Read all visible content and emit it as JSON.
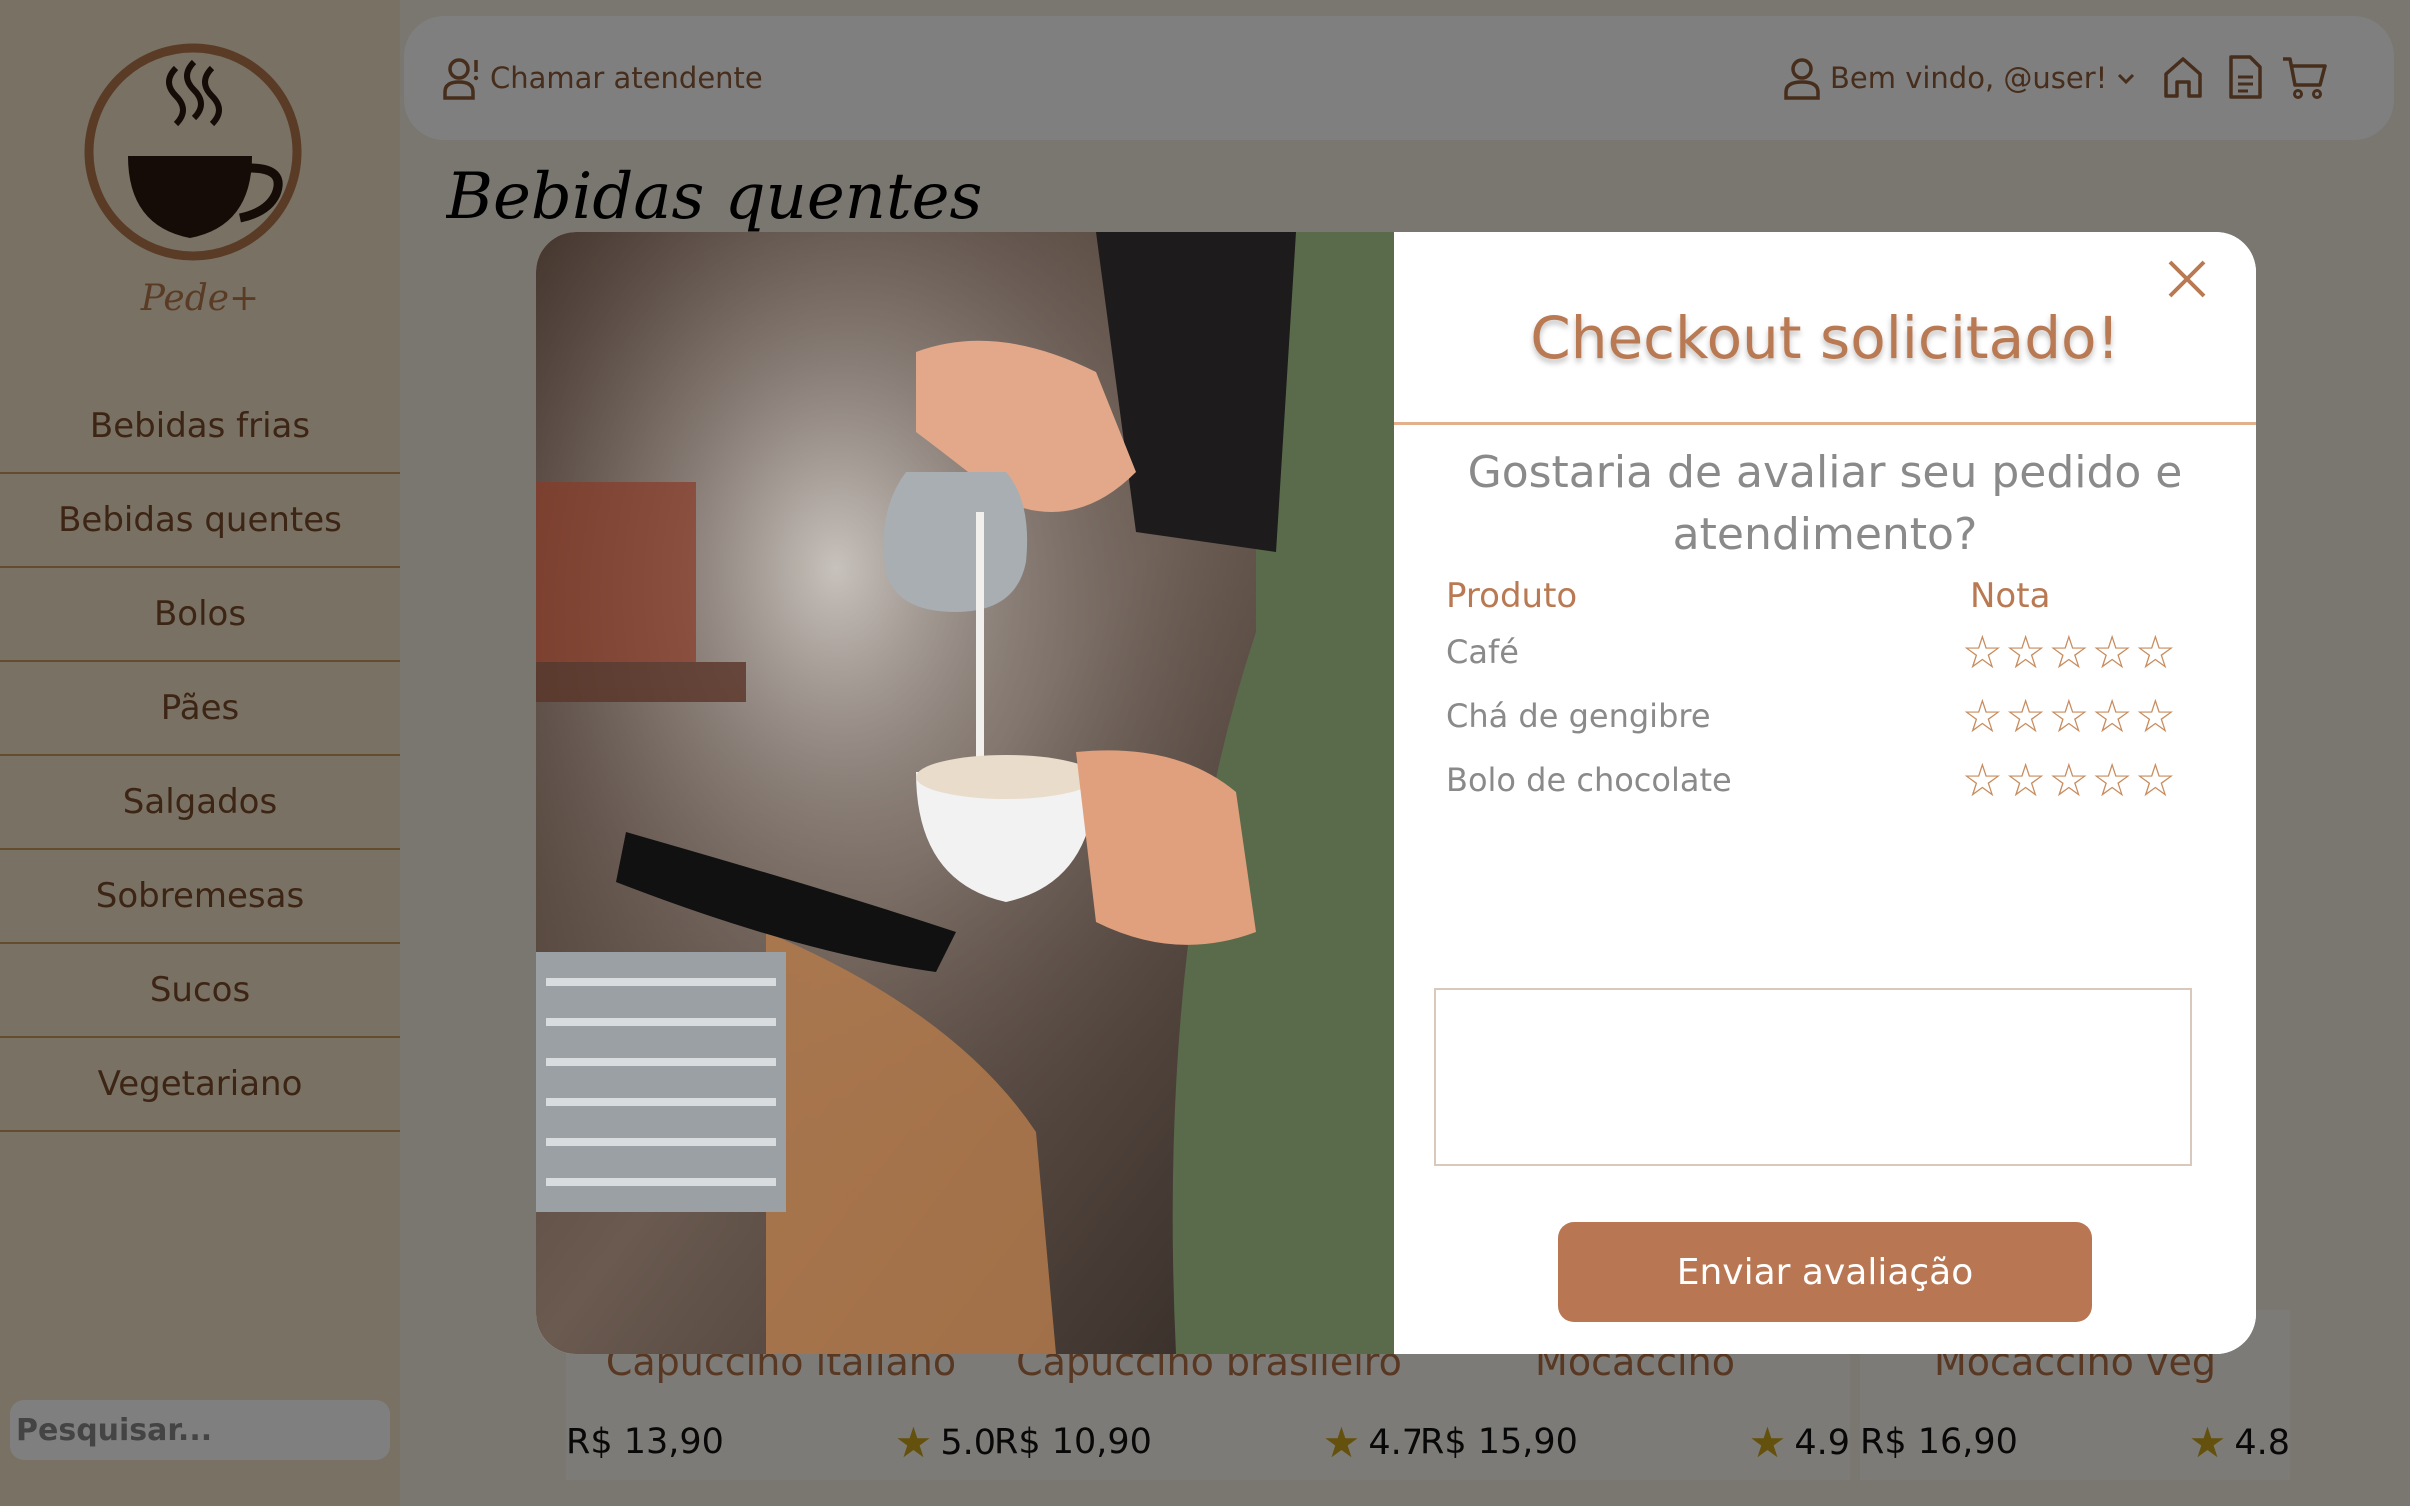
{
  "colors": {
    "accent": "#b97952",
    "sidebar_bg": "#f2e3c6",
    "overlay": "rgba(0,0,0,0.5)",
    "star_filled": "#c9a21c"
  },
  "brand": {
    "name": "Pede+",
    "logo_icon": "coffee-cup-icon"
  },
  "sidebar": {
    "items": [
      {
        "label": "Bebidas frias"
      },
      {
        "label": "Bebidas quentes"
      },
      {
        "label": "Bolos"
      },
      {
        "label": "Pães"
      },
      {
        "label": "Salgados"
      },
      {
        "label": "Sobremesas"
      },
      {
        "label": "Sucos"
      },
      {
        "label": "Vegetariano"
      }
    ],
    "search_placeholder": "Pesquisar..."
  },
  "topbar": {
    "call_attendant": "Chamar atendente",
    "welcome": "Bem vindo, @user!",
    "icons": [
      "home-icon",
      "document-icon",
      "cart-icon"
    ]
  },
  "page": {
    "title": "Bebidas quentes"
  },
  "products": [
    {
      "name": "Capuccino italiano",
      "price": "R$ 13,90",
      "rating": "5.0"
    },
    {
      "name": "Capuccino brasileiro",
      "price": "R$ 10,90",
      "rating": "4.7"
    },
    {
      "name": "Mocaccino",
      "price": "R$ 15,90",
      "rating": "4.9"
    },
    {
      "name": "Mocaccino veg",
      "price": "R$ 16,90",
      "rating": "4.8"
    }
  ],
  "modal": {
    "title": "Checkout solicitado!",
    "question": "Gostaria de avaliar seu pedido e atendimento?",
    "col_product": "Produto",
    "col_rating": "Nota",
    "items": [
      {
        "name": "Café",
        "stars": 0
      },
      {
        "name": "Chá de gengibre",
        "stars": 0
      },
      {
        "name": "Bolo de chocolate",
        "stars": 0
      }
    ],
    "submit_label": "Enviar avaliação",
    "image": "barista-pouring-milk-photo"
  }
}
